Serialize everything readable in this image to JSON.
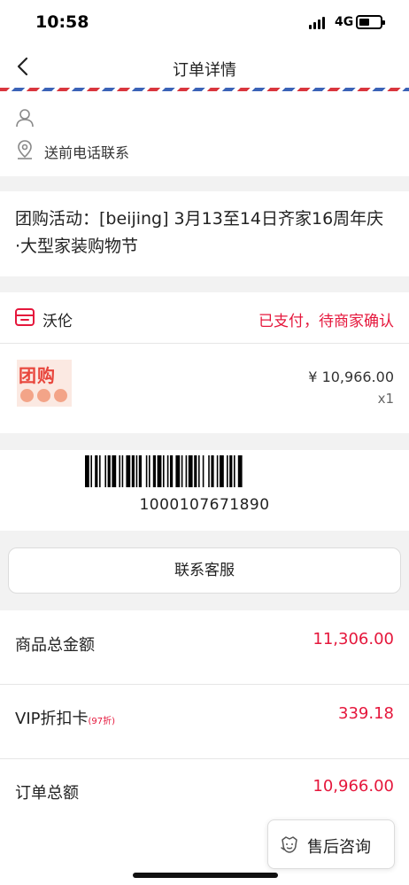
{
  "status_bar": {
    "time": "10:58",
    "network": "4G"
  },
  "nav": {
    "title": "订单详情"
  },
  "address": {
    "contact_note": "送前电话联系"
  },
  "activity": {
    "line1": "团购活动：[beijing] 3月13至14日齐家16周年庆",
    "line2": "·大型家装购物节"
  },
  "store": {
    "name": "沃伦",
    "status": "已支付，待商家确认",
    "status_color": "#e5173c"
  },
  "product": {
    "thumb_text": "团购",
    "price": "¥  10,966.00",
    "qty": "x1"
  },
  "barcode": {
    "number": "1000107671890"
  },
  "contact": {
    "label": "联系客服"
  },
  "summary": {
    "rows": [
      {
        "label": "商品总金额",
        "value": "11,306.00"
      },
      {
        "label": "VIP折扣卡",
        "sub": "(97折)",
        "value": "339.18"
      },
      {
        "label": "订单总额",
        "value": "10,966.00"
      }
    ]
  },
  "after_sale": {
    "label": "售后咨询"
  },
  "colors": {
    "accent_red": "#e5173c",
    "border": "#dcdcdc",
    "section_gap": "#f2f2f2"
  }
}
